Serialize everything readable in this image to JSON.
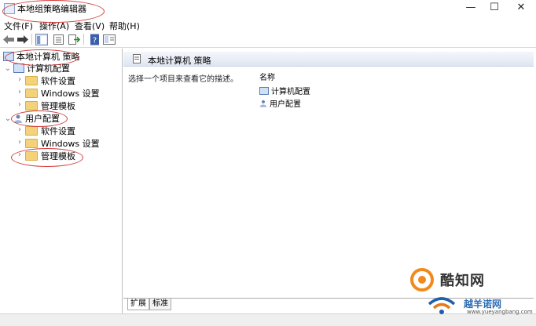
{
  "window": {
    "title": "本地组策略编辑器",
    "minimize_glyph": "—",
    "maximize_glyph": "☐",
    "close_glyph": "✕"
  },
  "menu": [
    {
      "label": "文件(F)"
    },
    {
      "label": "操作(A)"
    },
    {
      "label": "查看(V)"
    },
    {
      "label": "帮助(H)"
    }
  ],
  "toolbar": {
    "icons": [
      "back-arrow-icon",
      "forward-arrow-icon",
      "show-hide-tree-icon",
      "properties-icon",
      "export-list-icon",
      "help-icon",
      "show-pane-icon"
    ]
  },
  "tree": {
    "root": "本地计算机 策略",
    "computer_config": "计算机配置",
    "software_settings_1": "软件设置",
    "windows_settings_1": "Windows 设置",
    "admin_templates_1": "管理模板",
    "user_config": "用户配置",
    "software_settings_2": "软件设置",
    "windows_settings_2": "Windows 设置",
    "admin_templates_2": "管理模板"
  },
  "details": {
    "header_title": "本地计算机 策略",
    "description": "选择一个项目来查看它的描述。",
    "column_name": "名称",
    "items": [
      {
        "label": "计算机配置"
      },
      {
        "label": "用户配置"
      }
    ]
  },
  "tabs": {
    "extended": "扩展",
    "standard": "标准"
  },
  "watermark": {
    "brand": "酷知网",
    "site": "越羊诺网",
    "url": "www.yueyangbang.com"
  },
  "colors": {
    "annotation_red": "#d43a3a",
    "folder_yellow": "#f3d27a"
  }
}
